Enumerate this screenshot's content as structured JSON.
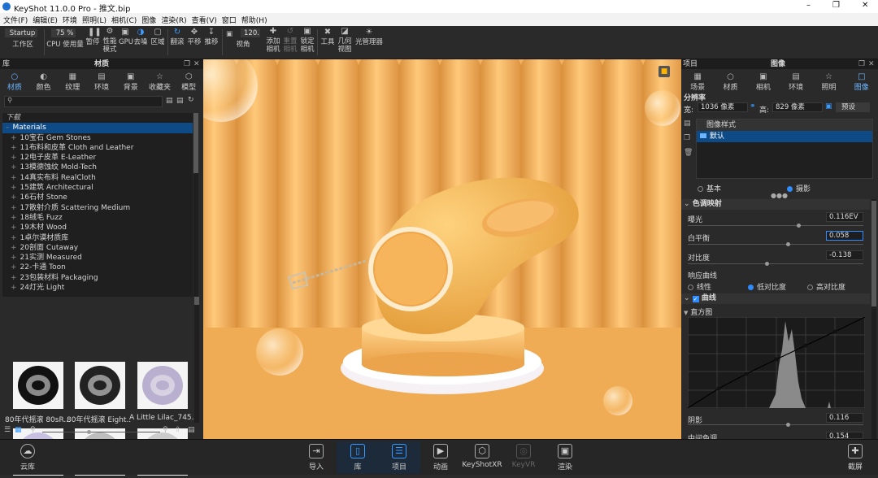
{
  "window": {
    "title": "KeyShot 11.0.0 Pro  - 推文.bip"
  },
  "menu": [
    "文件(F)",
    "编辑(E)",
    "环境",
    "照明(L)",
    "相机(C)",
    "图像",
    "渲染(R)",
    "查看(V)",
    "窗口",
    "帮助(H)"
  ],
  "toolbar": {
    "workspace_value": "Startup",
    "workspace_label": "工作区",
    "cpu_value": "75 %",
    "cpu_label": "CPU 使用量",
    "pause_label": "暂停",
    "perf_label": "性能\n模式",
    "gpu_label": "GPU",
    "denoise_label": "去噪",
    "region_label": "区域",
    "tumble_label": "翻滚",
    "pan_label": "平移",
    "dolly_label": "推移",
    "fov_value": "120.0",
    "fov_label": "视角",
    "add_camera_label": "添加\n相机",
    "reset_camera_label": "重置\n相机",
    "lock_camera_label": "锁定\n相机",
    "tools_label": "工具",
    "geometry_view_label": "几何\n视图",
    "light_manager_label": "光管理器"
  },
  "library": {
    "panel_title": "库",
    "section_title": "材质",
    "tabs": [
      {
        "label": "材质",
        "icon": "sphere-icon"
      },
      {
        "label": "颜色",
        "icon": "palette-icon"
      },
      {
        "label": "纹理",
        "icon": "texture-icon"
      },
      {
        "label": "环境",
        "icon": "environment-icon"
      },
      {
        "label": "背景",
        "icon": "background-icon"
      },
      {
        "label": "收藏夹",
        "icon": "star-icon"
      },
      {
        "label": "模型",
        "icon": "cube-icon"
      }
    ],
    "tree_header": "下载",
    "tree_root": "Materials",
    "tree_items": [
      "10宝石 Gem Stones",
      "11布料和皮革 Cloth and Leather",
      "12电子皮革 E-Leather",
      "13模德蚀纹 Mold-Tech",
      "14真实布料 RealCloth",
      "15建筑 Architectural",
      "16石材 Stone",
      "17散射介质 Scattering Medium",
      "18绒毛 Fuzz",
      "19木材 Wood",
      "1卓尔谟材质库",
      "20剖面 Cutaway",
      "21实测 Measured",
      "22-卡通 Toon",
      "23包装材料 Packaging",
      "24灯光 Light"
    ],
    "thumbnails": [
      {
        "label": "80年代摇滚 80sR..."
      },
      {
        "label": "80年代摇滚 Eight..."
      },
      {
        "label": "A Little Lilac_745..."
      },
      {
        "label": ""
      },
      {
        "label": ""
      },
      {
        "label": ""
      }
    ]
  },
  "project": {
    "panel_title": "项目",
    "section_title": "图像",
    "tabs": [
      {
        "label": "场景"
      },
      {
        "label": "材质"
      },
      {
        "label": "相机"
      },
      {
        "label": "环境"
      },
      {
        "label": "照明"
      },
      {
        "label": "图像"
      }
    ],
    "resolution_title": "分辨率",
    "width_label": "宽:",
    "width_value": "1036 像素",
    "height_label": "高:",
    "height_value": "829 像素",
    "preset_label": "预设",
    "style_header": "图像样式",
    "style_item": "默认",
    "mode_basic": "基本",
    "mode_photo": "摄影",
    "tone_title": "色调映射",
    "exposure_label": "曝光",
    "exposure_value": "0.116EV",
    "exposure_level": 0.62,
    "wb_label": "白平衡",
    "wb_value": "0.058",
    "wb_level": 0.56,
    "contrast_label": "对比度",
    "contrast_value": "-0.138",
    "contrast_level": 0.44,
    "curve_label": "响应曲线",
    "curve_linear": "线性",
    "curve_low": "低对比度",
    "curve_high": "高对比度",
    "curves_title": "曲线",
    "histogram_title": "直方图",
    "shadow_label": "阴影",
    "shadow_value": "0.116",
    "shadow_level": 0.56,
    "midtone_label": "中间色调",
    "midtone_value": "0.154"
  },
  "bottom": {
    "cloud_label": "云库",
    "tabs": [
      {
        "label": "导入"
      },
      {
        "label": "库"
      },
      {
        "label": "项目"
      },
      {
        "label": "动画"
      },
      {
        "label": "KeyShotXR"
      },
      {
        "label": "KeyVR"
      },
      {
        "label": "渲染"
      }
    ],
    "screenshot_label": "截屏"
  },
  "colors": {
    "accent": "#2f8cff",
    "viewport": "#f1b160"
  }
}
